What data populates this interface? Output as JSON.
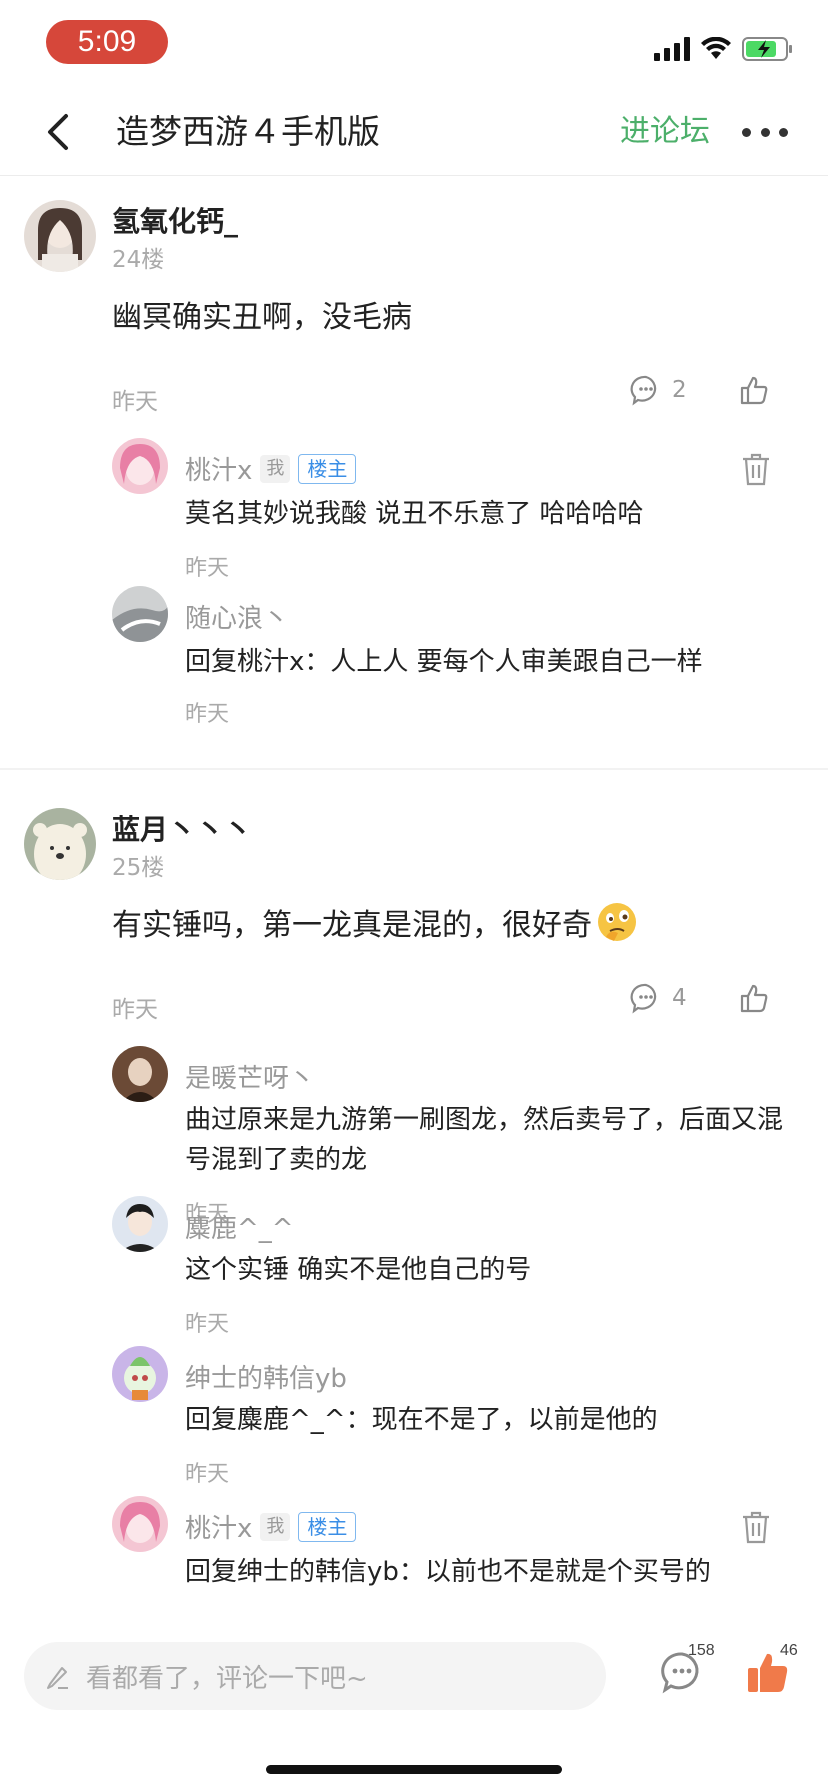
{
  "status_bar": {
    "time": "5:09",
    "time_pill_color": "#d6473a",
    "icons": [
      "signal-icon",
      "wifi-icon",
      "battery-charging-icon"
    ]
  },
  "nav": {
    "title": "造梦西游４手机版",
    "forum_link": "进论坛",
    "back_icon": "chevron-left-icon",
    "more_icon": "more-dots-icon"
  },
  "comments": [
    {
      "user": "氢氧化钙_",
      "floor": "24楼",
      "text": "幽冥确实丑啊，没毛病",
      "time": "昨天",
      "reply_count": "2",
      "replies": [
        {
          "user": "桃汁x",
          "me_badge": "我",
          "host_badge": "楼主",
          "text": "莫名其妙说我酸 说丑不乐意了 哈哈哈哈",
          "time": "昨天"
        },
        {
          "user": "随心浪丶",
          "text": "回复桃汁x：人上人 要每个人审美跟自己一样",
          "time": "昨天"
        }
      ]
    },
    {
      "user": "蓝月丶丶丶",
      "floor": "25楼",
      "text": "有实锤吗，第一龙真是混的，很好奇",
      "emoji": "thinking-face-icon",
      "time": "昨天",
      "reply_count": "4",
      "replies": [
        {
          "user": "是暖芒呀丶",
          "text": "曲过原来是九游第一刷图龙，然后卖号了，后面又混号混到了卖的龙",
          "time": "昨天"
        },
        {
          "user": "麋鹿^_^",
          "text": "这个实锤 确实不是他自己的号",
          "time": "昨天"
        },
        {
          "user": "绅士的韩信yb",
          "text": "回复麋鹿^_^：现在不是了，以前是他的",
          "time": "昨天"
        },
        {
          "user": "桃汁x",
          "me_badge": "我",
          "host_badge": "楼主",
          "text": "回复绅士的韩信yb：以前也不是就是个买号的",
          "time": ""
        }
      ]
    }
  ],
  "bottom_bar": {
    "placeholder": "看都看了，评论一下吧~",
    "comment_count": "158",
    "like_count": "46",
    "accent": "#f07a4a"
  }
}
